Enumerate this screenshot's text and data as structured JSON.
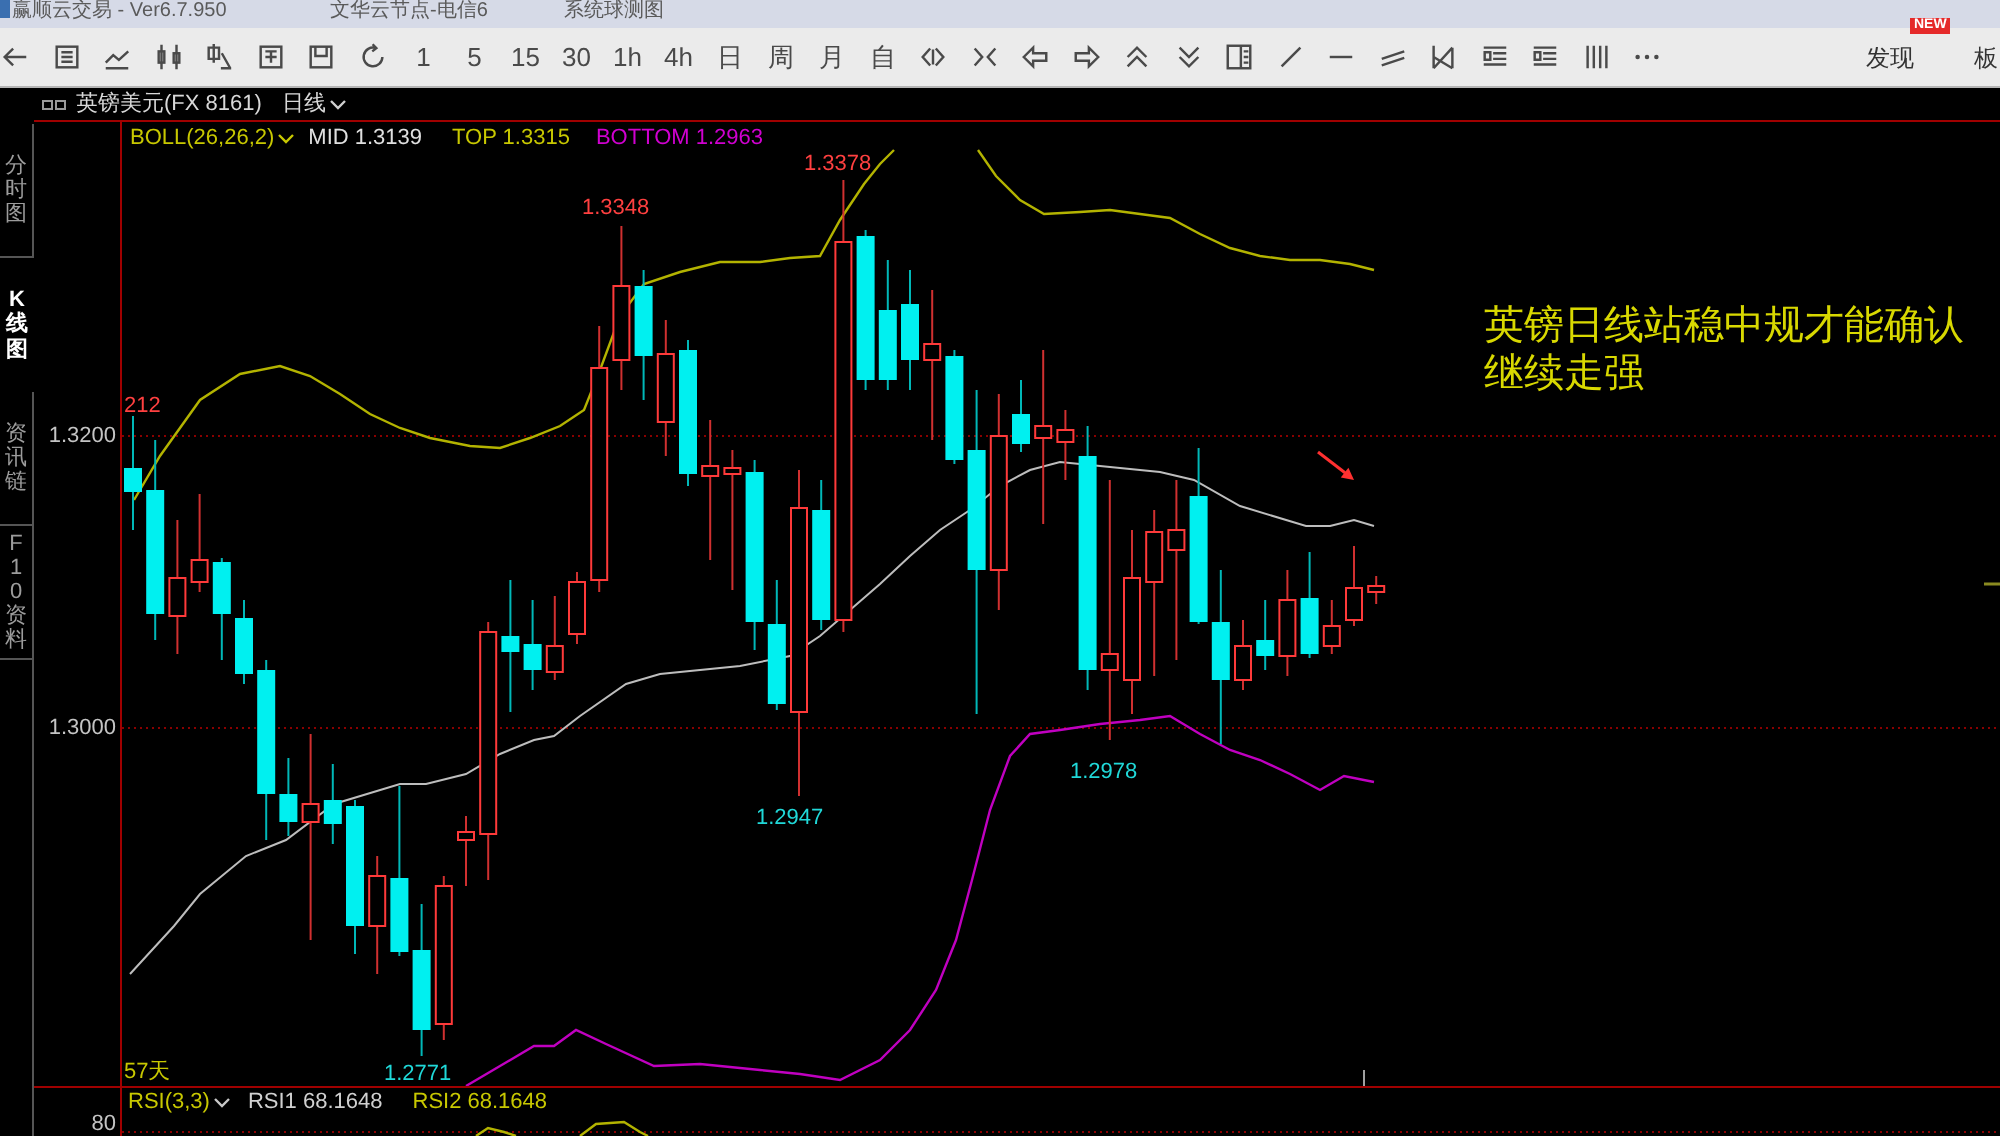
{
  "window": {
    "title": "赢顺云交易 - Ver6.7.950",
    "server": "文华云节点-电信6",
    "layout": "系统球测图"
  },
  "toolbar": {
    "periods": [
      "1",
      "5",
      "15",
      "30",
      "1h",
      "4h",
      "日",
      "周",
      "月",
      "自"
    ],
    "discover": {
      "label": "发现",
      "badge": "NEW"
    },
    "next_tab": "板"
  },
  "symbol_bar": {
    "symbol": "英镑美元(FX 8161)",
    "period": "日线"
  },
  "side_tabs": [
    {
      "label": "分时图",
      "selected": false
    },
    {
      "label": "K线图",
      "selected": true
    },
    {
      "label": "资讯链",
      "selected": false
    },
    {
      "label": "F10资料",
      "selected": false
    }
  ],
  "price_axis": {
    "ticks": [
      "1.3200",
      "1.3000"
    ]
  },
  "chart": {
    "indicator": {
      "name": "BOLL(26,26,2)",
      "mid": "MID 1.3139",
      "top": "TOP 1.3315",
      "bottom": "BOTTOM 1.2963"
    },
    "edge_label": "212",
    "high_labels": [
      "1.3348",
      "1.3378"
    ],
    "low_labels": [
      "1.2947",
      "1.2978",
      "1.2771"
    ],
    "note": "英镑日线站稳中规才能确认继续走强",
    "bar_count": "57天"
  },
  "rsi": {
    "name": "RSI(3,3)",
    "rsi1": "RSI1 68.1648",
    "rsi2": "RSI2 68.1648",
    "axis": "80"
  }
}
